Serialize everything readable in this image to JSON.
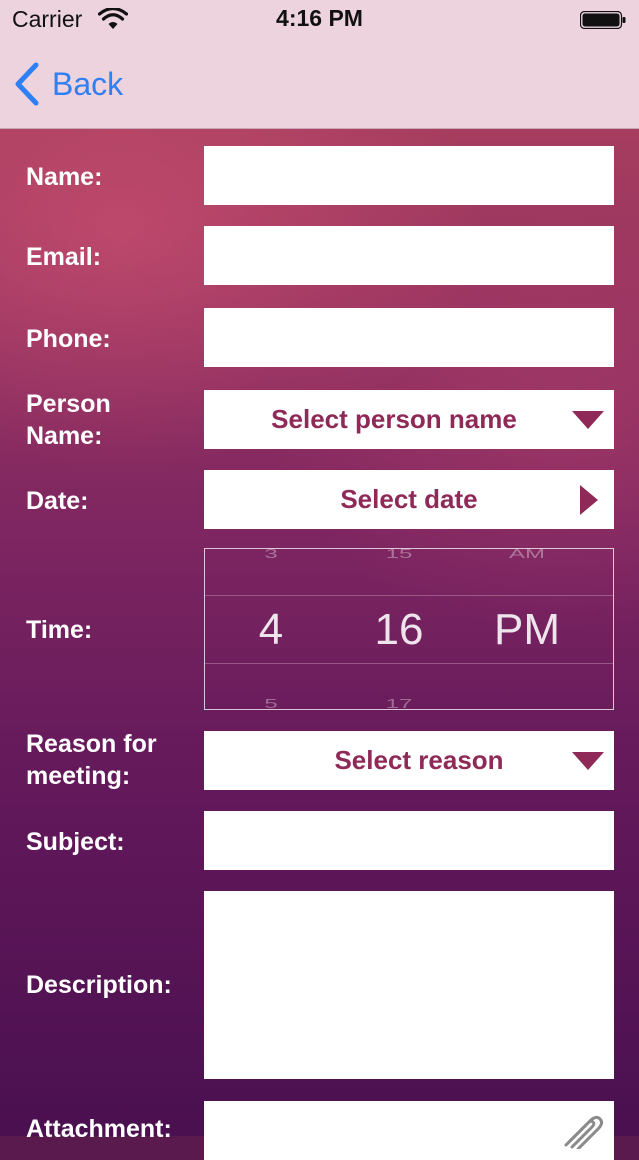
{
  "status_bar": {
    "carrier": "Carrier",
    "time": "4:16 PM"
  },
  "nav": {
    "back_label": "Back"
  },
  "form": {
    "name_label": "Name:",
    "email_label": "Email:",
    "phone_label": "Phone:",
    "person_label": "Person Name:",
    "person_value": "Select person name",
    "date_label": "Date:",
    "date_value": "Select date",
    "time_label": "Time:",
    "reason_label": "Reason for meeting:",
    "reason_value": "Select reason",
    "subject_label": "Subject:",
    "description_label": "Description:",
    "attachment_label": "Attachment:"
  },
  "time_picker": {
    "hour": "4",
    "minute": "16",
    "period": "PM",
    "hour_above": "3",
    "minute_above": "15",
    "period_above": "AM",
    "hour_below": "5",
    "minute_below": "17"
  },
  "colors": {
    "accent": "#8f2a58",
    "nav_back": "#2f7ff5",
    "nav_bg": "#ecd3de"
  },
  "icons": {
    "back": "chevron-left-icon",
    "person_dropdown": "caret-down-icon",
    "date_picker": "caret-right-icon",
    "reason_dropdown": "caret-down-icon",
    "attachment": "paperclip-icon"
  }
}
